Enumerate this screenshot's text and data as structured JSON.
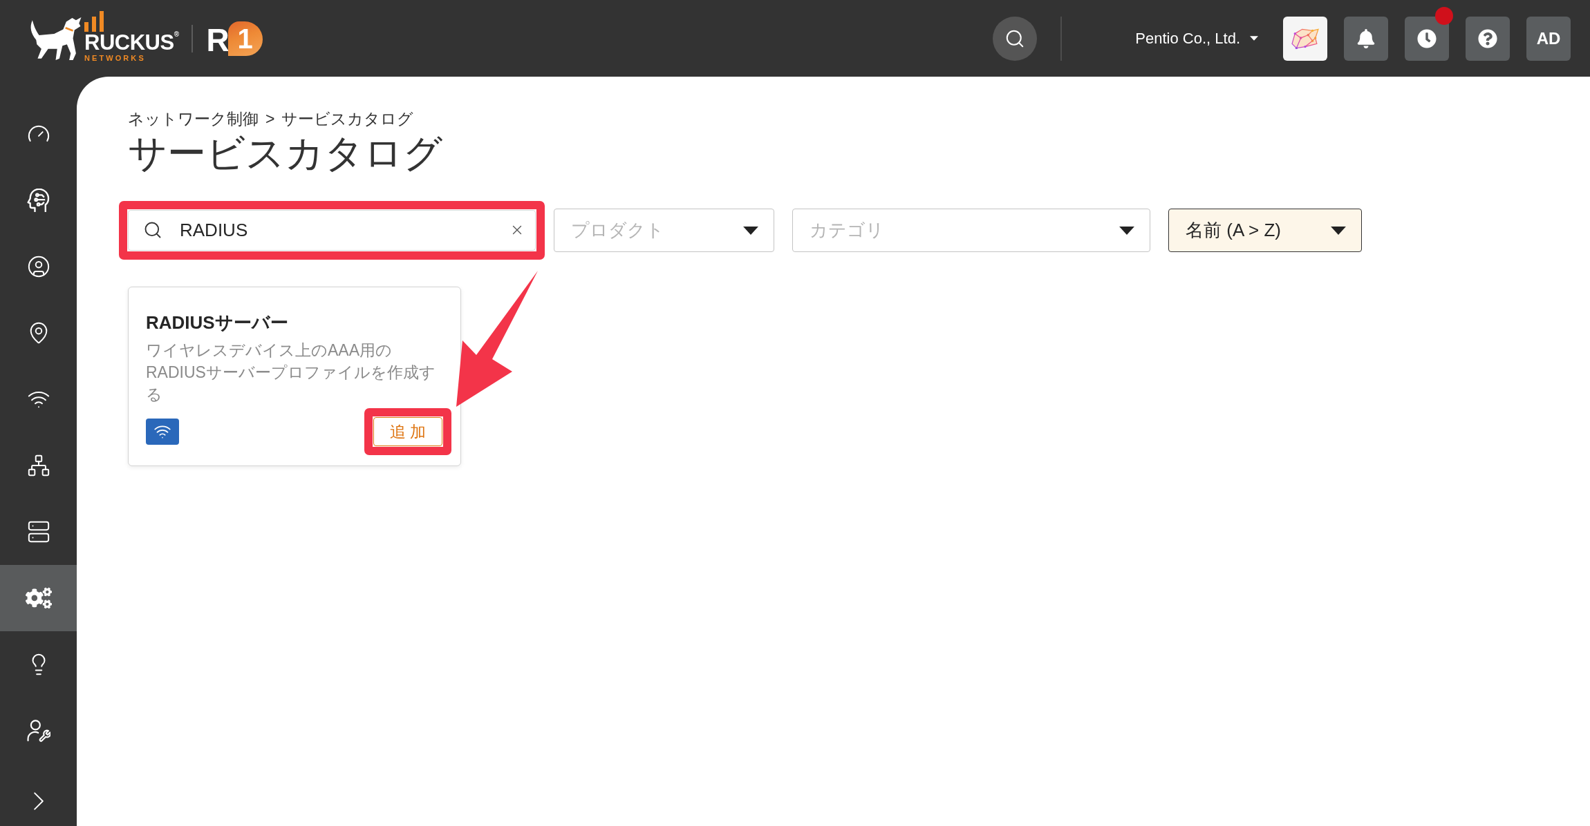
{
  "header": {
    "logo": {
      "brand": "RUCKUS$^{®}$",
      "tagline": "NETWORKS",
      "product": {
        "letter": "R",
        "number": "1"
      }
    },
    "account": {
      "name": "Pentio Co., Ltd."
    },
    "history": {
      "alert": true
    },
    "user": {
      "initials": "AD"
    }
  },
  "sidebar": {
    "items": [
      {
        "selected": false
      },
      {
        "selected": false
      },
      {
        "selected": false
      },
      {
        "selected": false
      },
      {
        "selected": false
      },
      {
        "selected": false
      },
      {
        "selected": false
      },
      {
        "selected": true
      },
      {
        "selected": false
      },
      {
        "selected": false
      }
    ]
  },
  "breadcrumb": {
    "items": [
      "ネットワーク制御",
      "サービスカタログ"
    ],
    "separator": ">"
  },
  "title": "サービスカタログ",
  "filters": {
    "search": {
      "value": "RADIUS",
      "highlighted": true
    },
    "product": {
      "placeholder": "プロダクト"
    },
    "category": {
      "placeholder": "カテゴリ"
    },
    "sort": {
      "value": "名前 (A > Z)"
    }
  },
  "cards": [
    {
      "title": "RADIUSサーバー",
      "description": "ワイヤレスデバイス上のAAA用のRADIUSサーバープロファイルを作成する",
      "action": {
        "label": "追 加",
        "highlighted": true
      }
    }
  ]
}
